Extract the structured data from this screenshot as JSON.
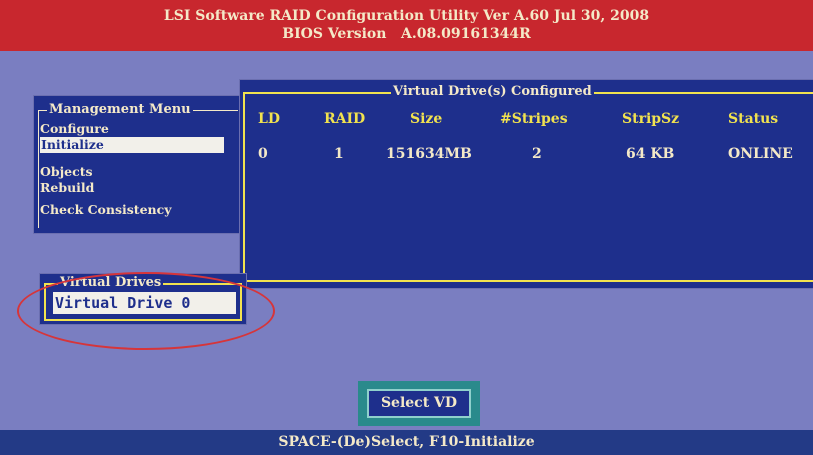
{
  "header": {
    "title_line1": "LSI Software RAID Configuration Utility Ver A.60 Jul 30, 2008",
    "title_line2": "BIOS Version   A.08.09161344R"
  },
  "management_menu": {
    "title": "Management Menu",
    "items": [
      {
        "label": "Configure"
      },
      {
        "label": "Initialize"
      },
      {
        "label": "Objects"
      },
      {
        "label": "Rebuild"
      },
      {
        "label": "Check Consistency"
      }
    ],
    "selected": "Initialize"
  },
  "virtual_drives_configured": {
    "title": "Virtual Drive(s) Configured",
    "columns": [
      "LD",
      "RAID",
      "Size",
      "#Stripes",
      "StripSz",
      "Status"
    ],
    "rows": [
      {
        "ld": "0",
        "raid": "1",
        "size": "151634MB",
        "stripes": "2",
        "stripsz": "64 KB",
        "status": "ONLINE"
      }
    ]
  },
  "virtual_drives": {
    "title": "Virtual Drives",
    "items": [
      {
        "label": "Virtual Drive 0"
      }
    ]
  },
  "select_button": {
    "label": "Select VD"
  },
  "footer": {
    "text": "SPACE-(De)Select,  F10-Initialize"
  },
  "colors": {
    "background": "#7a7ec1",
    "header_bg": "#c8272e",
    "panel_bg": "#1e2f8c",
    "frame": "#f1e24f",
    "highlight_bg": "#f2f0ea",
    "annotation_circle": "#d6353a",
    "button_bg": "#2a8a8c"
  }
}
